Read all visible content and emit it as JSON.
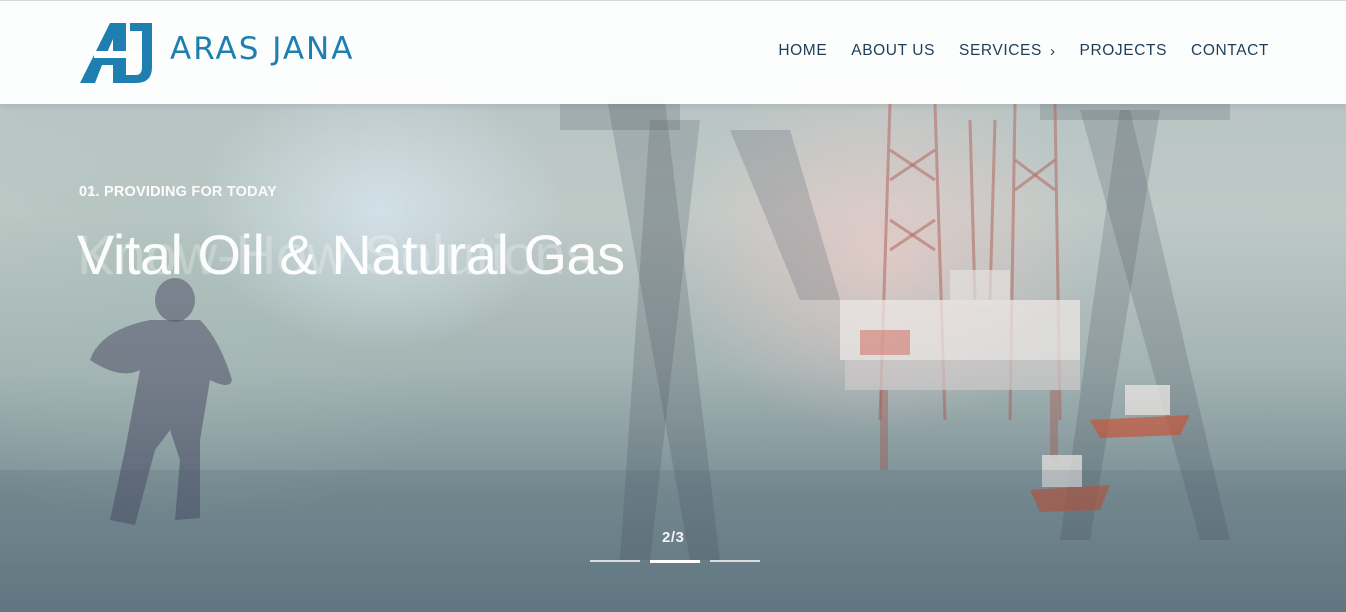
{
  "brand": {
    "name": "ARAS JANA",
    "colors": {
      "primary": "#1f7fb0",
      "dark": "#1f3d57"
    }
  },
  "nav": {
    "items": [
      {
        "label": "HOME"
      },
      {
        "label": "ABOUT US"
      },
      {
        "label": "SERVICES",
        "icon": "chevron-right-icon"
      },
      {
        "label": "PROJECTS"
      },
      {
        "label": "CONTACT"
      }
    ]
  },
  "hero": {
    "kicker": "01. PROVIDING FOR TODAY",
    "kicker_previous": "02. PROVIDING",
    "headline": "Vital Oil & Natural Gas",
    "headline_previous": "Know-How Solutions",
    "counter": "2/3",
    "slides": {
      "total": 3,
      "active": 2
    }
  }
}
